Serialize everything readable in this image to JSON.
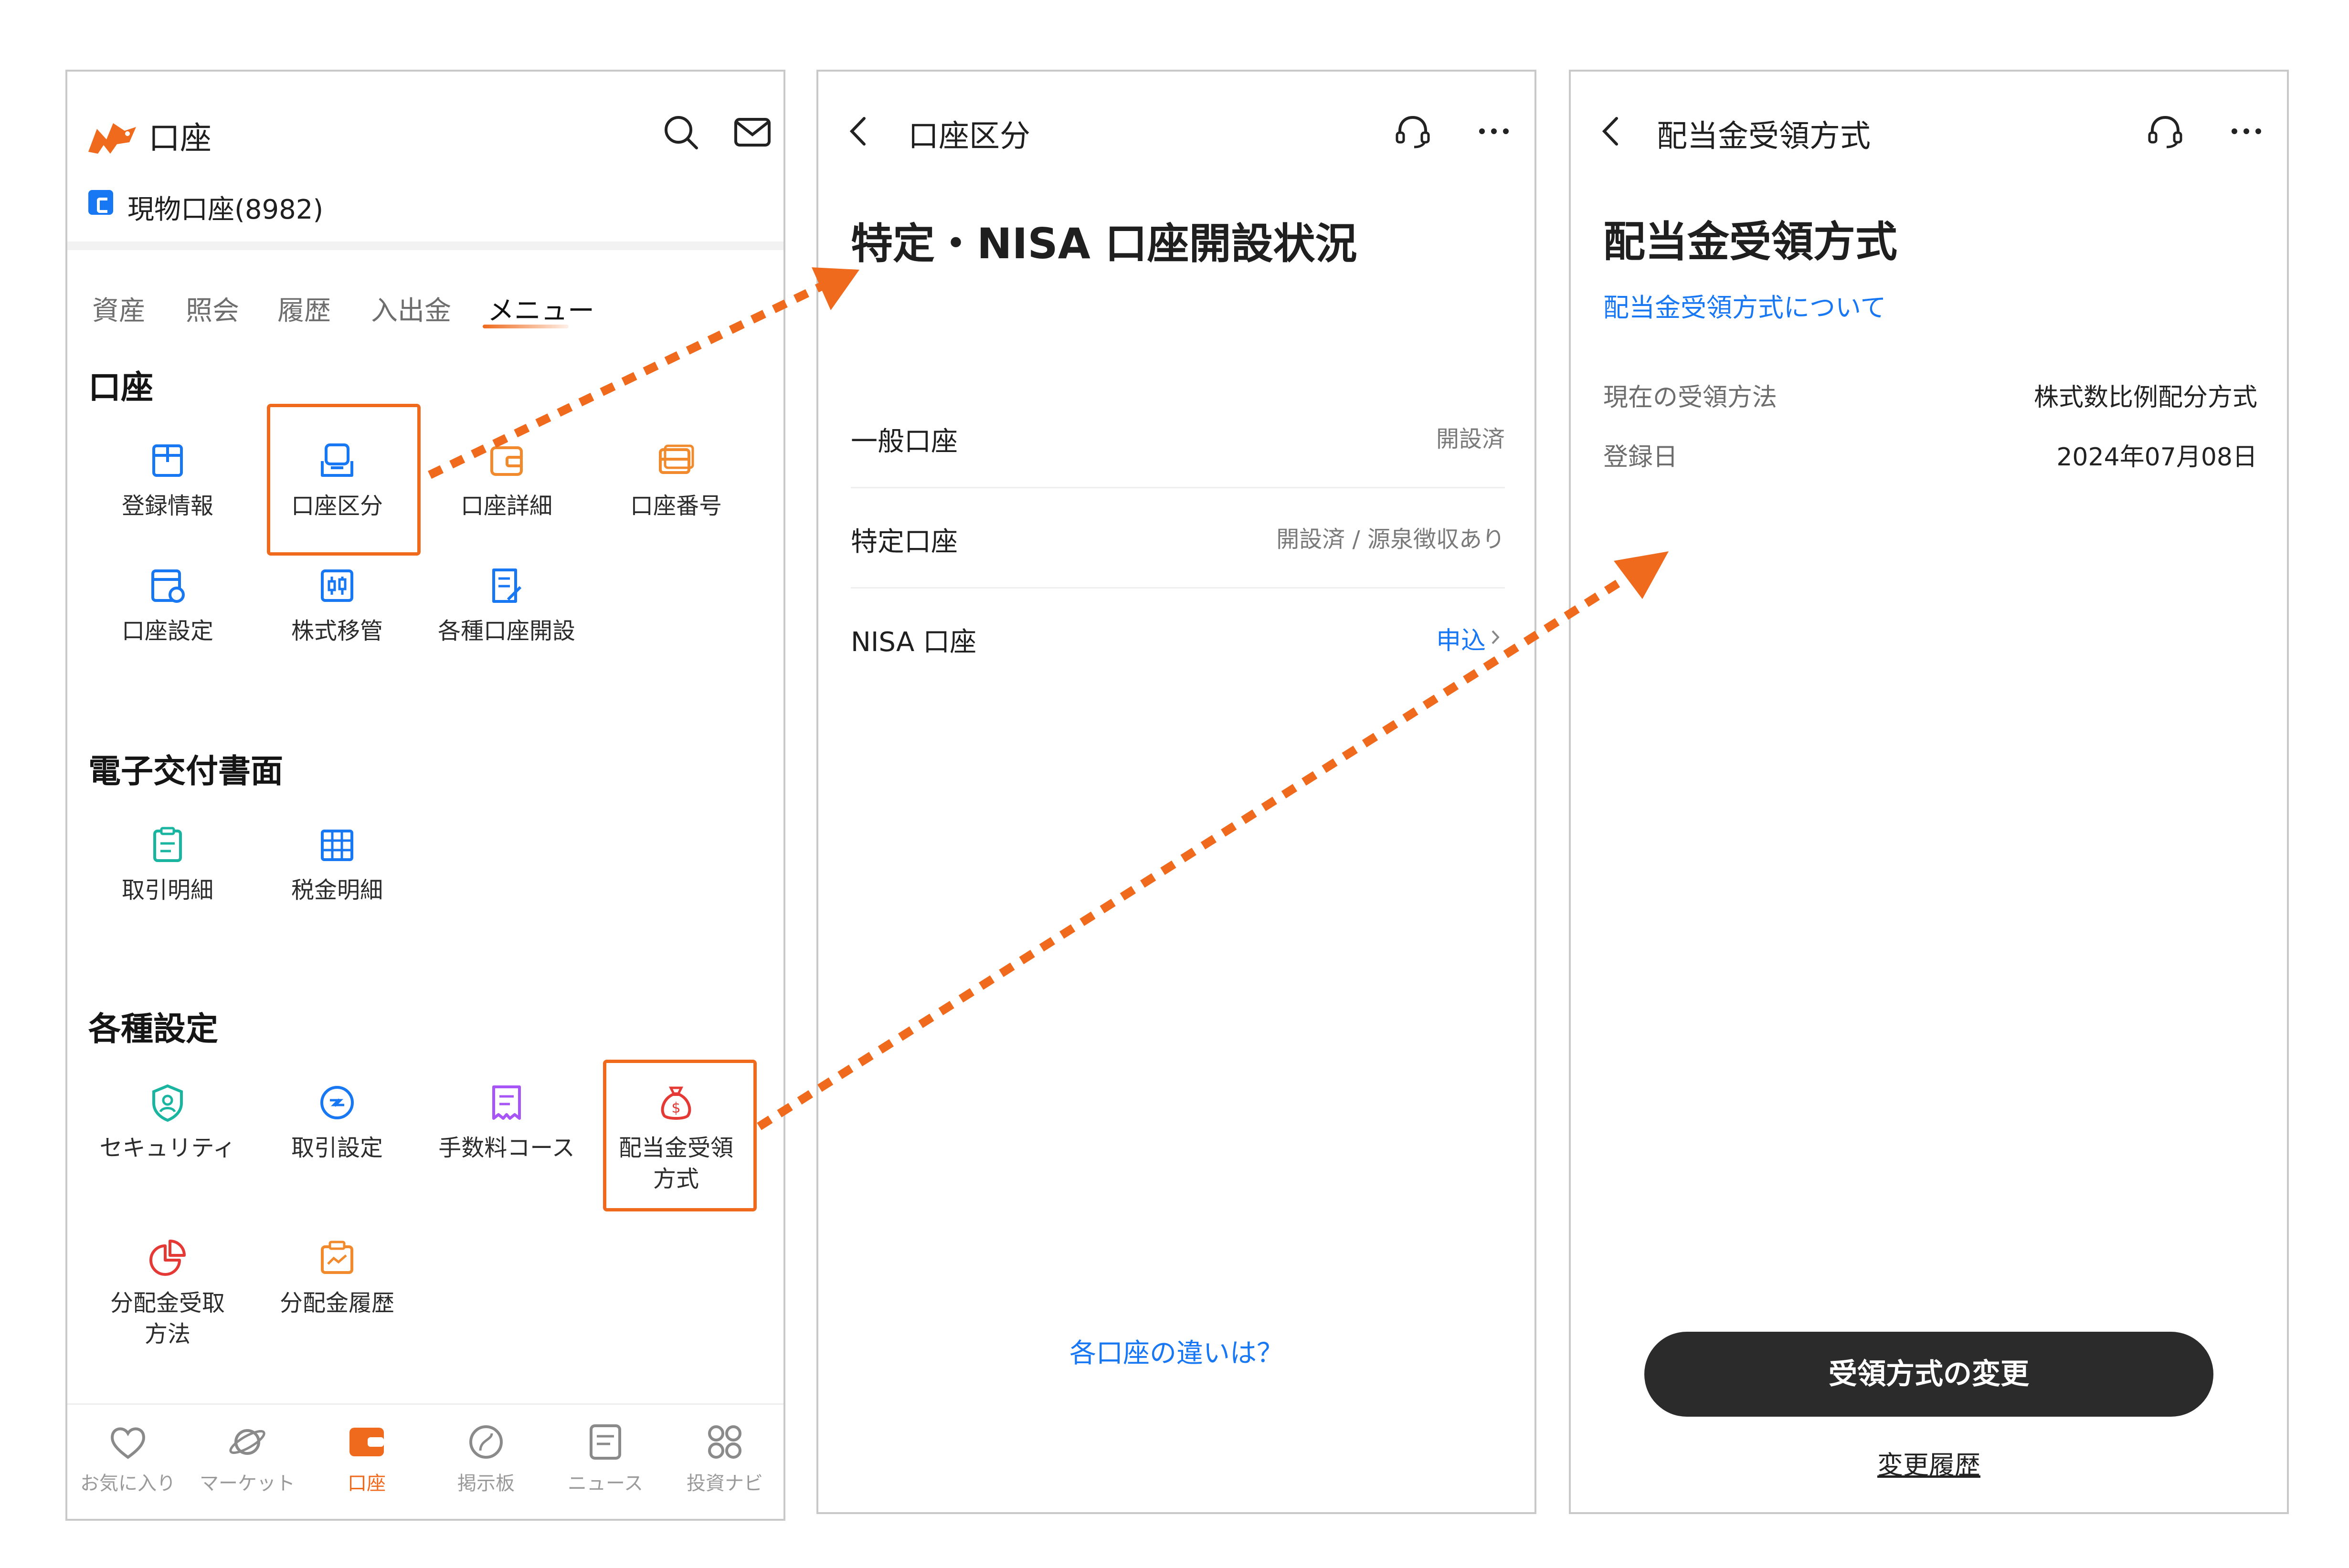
{
  "panel1": {
    "title": "口座",
    "account": "現物口座(8982)",
    "tabs": [
      "資産",
      "照会",
      "履歴",
      "入出金",
      "メニュー"
    ],
    "sections": [
      {
        "title": "口座",
        "items": [
          "登録情報",
          "口座区分",
          "口座詳細",
          "口座番号",
          "口座設定",
          "株式移管",
          "各種口座開設"
        ]
      },
      {
        "title": "電子交付書面",
        "items": [
          "取引明細",
          "税金明細"
        ]
      },
      {
        "title": "各種設定",
        "items": [
          "セキュリティ",
          "取引設定",
          "手数料コース",
          "配当金受領\n方式",
          "分配金受取\n方法",
          "分配金履歴"
        ]
      }
    ],
    "nav": [
      "お気に入り",
      "マーケット",
      "口座",
      "掲示板",
      "ニュース",
      "投資ナビ"
    ],
    "colors": {
      "accent": "#ef6a1d",
      "blue": "#1877f2"
    }
  },
  "panel2": {
    "nav_title": "口座区分",
    "title": "特定・NISA 口座開設状況",
    "rows": [
      {
        "label": "一般口座",
        "value": "開設済"
      },
      {
        "label": "特定口座",
        "value": "開設済 / 源泉徴収あり"
      },
      {
        "label": "NISA 口座",
        "value": "申込"
      }
    ],
    "footer_link": "各口座の違いは？"
  },
  "panel3": {
    "nav_title": "配当金受領方式",
    "title": "配当金受領方式",
    "about_link": "配当金受領方式について",
    "fields": [
      {
        "label": "現在の受領方法",
        "value": "株式数比例配分方式"
      },
      {
        "label": "登録日",
        "value": "2024年07月08日"
      }
    ],
    "button": "受領方式の変更",
    "history_link": "変更履歴"
  }
}
